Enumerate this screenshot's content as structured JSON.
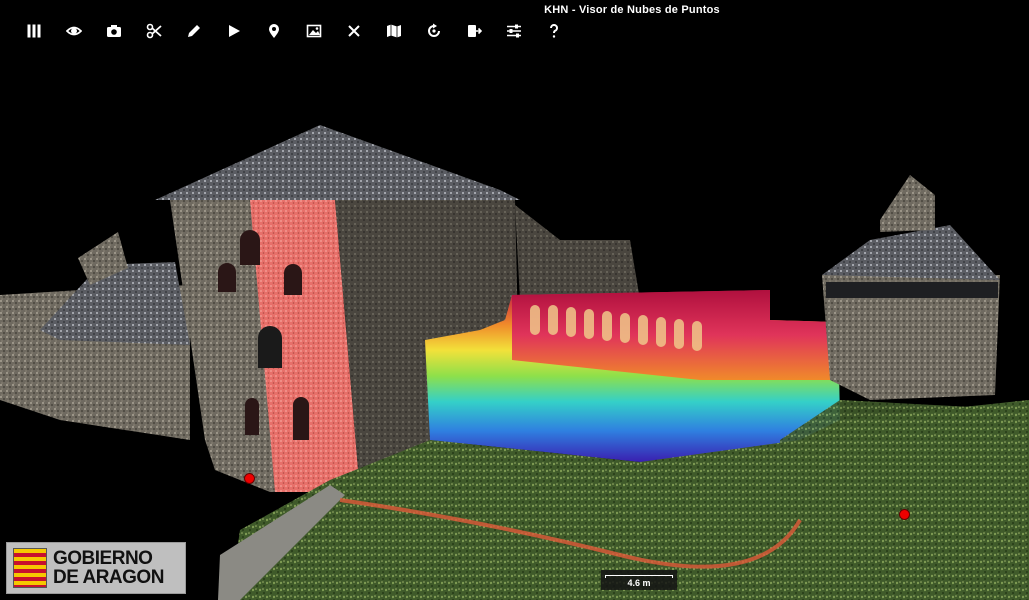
{
  "app": {
    "title": "KHN - Visor de Nubes de Puntos"
  },
  "toolbar": {
    "items": [
      {
        "name": "menu-icon",
        "glyph": "bars"
      },
      {
        "name": "eye-icon",
        "glyph": "eye"
      },
      {
        "name": "camera-icon",
        "glyph": "camera"
      },
      {
        "name": "scissors-icon",
        "glyph": "scissors"
      },
      {
        "name": "pencil-icon",
        "glyph": "pencil"
      },
      {
        "name": "play-icon",
        "glyph": "play"
      },
      {
        "name": "map-pin-icon",
        "glyph": "pin"
      },
      {
        "name": "image-icon",
        "glyph": "image"
      },
      {
        "name": "close-icon",
        "glyph": "x"
      },
      {
        "name": "map-icon",
        "glyph": "map"
      },
      {
        "name": "rotate-icon",
        "glyph": "rotate"
      },
      {
        "name": "export-icon",
        "glyph": "export"
      },
      {
        "name": "sliders-icon",
        "glyph": "sliders"
      },
      {
        "name": "help-icon",
        "glyph": "question"
      }
    ]
  },
  "logo": {
    "line1": "GOBIERNO",
    "line2": "DE ARAGON",
    "colors": {
      "yellow": "#f6c800",
      "red": "#c8102e",
      "panel": "#bfbfbf"
    }
  },
  "scale": {
    "label": "4.6 m"
  }
}
